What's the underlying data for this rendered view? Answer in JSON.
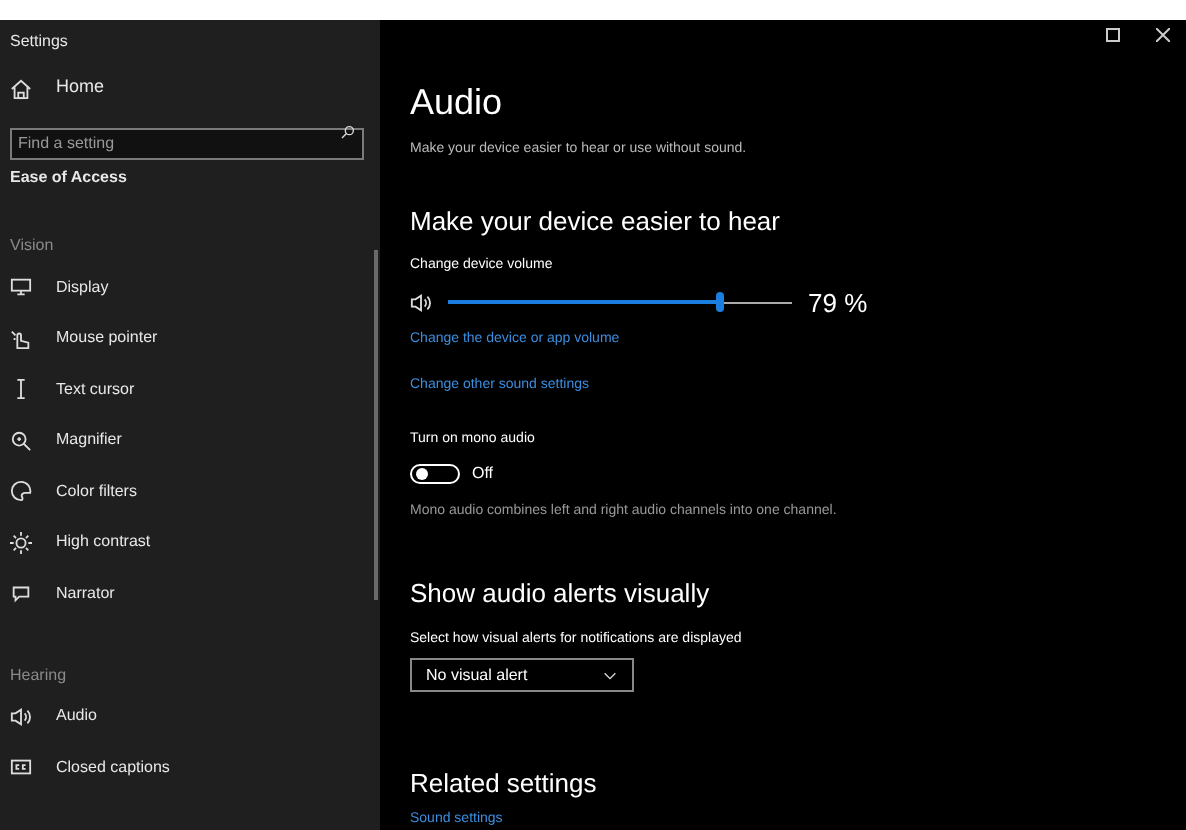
{
  "window": {
    "title": "Settings"
  },
  "sidebar": {
    "home": "Home",
    "search": {
      "placeholder": "Find a setting"
    },
    "category": "Ease of Access",
    "groups": [
      {
        "heading": "Vision",
        "items": [
          {
            "kind": "display",
            "label": "Display"
          },
          {
            "kind": "pointer",
            "label": "Mouse pointer"
          },
          {
            "kind": "cursor",
            "label": "Text cursor"
          },
          {
            "kind": "magnifier",
            "label": "Magnifier"
          },
          {
            "kind": "filters",
            "label": "Color filters"
          },
          {
            "kind": "contrast",
            "label": "High contrast"
          },
          {
            "kind": "narrator",
            "label": "Narrator"
          }
        ]
      },
      {
        "heading": "Hearing",
        "items": [
          {
            "kind": "audio",
            "label": "Audio"
          },
          {
            "kind": "captions",
            "label": "Closed captions"
          }
        ]
      }
    ]
  },
  "page": {
    "title": "Audio",
    "description": "Make your device easier to hear or use without sound.",
    "hear": {
      "heading": "Make your device easier to hear",
      "volume_label": "Change device volume",
      "volume": {
        "level": 0.79,
        "reading": "79 %"
      },
      "links": [
        "Change the device or app volume",
        "Change other sound settings"
      ],
      "mono": {
        "label": "Turn on mono audio",
        "on": false,
        "state": "Off",
        "description": "Mono audio combines left and right audio channels into one channel."
      }
    },
    "alerts": {
      "heading": "Show audio alerts visually",
      "label": "Select how visual alerts for notifications are displayed",
      "dropdown": "No visual alert"
    },
    "related": {
      "heading": "Related settings",
      "links": [
        "Sound settings"
      ]
    }
  }
}
